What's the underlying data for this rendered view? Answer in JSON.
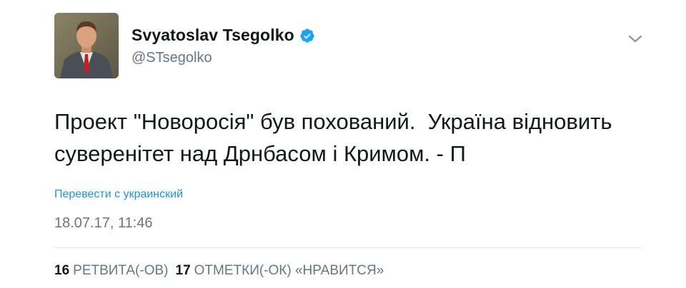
{
  "author": {
    "name": "Svyatoslav Tsegolko",
    "handle": "@STsegolko",
    "verified": true,
    "verified_icon": "verified-badge-icon",
    "avatar_icon": "profile-photo"
  },
  "menu": {
    "icon": "chevron-down-icon"
  },
  "tweet": {
    "text": "Проект \"Новоросія\" був похований.  Україна відновить суверенітет над Дрнбасом і Кримом. - П",
    "translate_label": "Перевести с украинский",
    "timestamp": "18.07.17, 11:46"
  },
  "stats": {
    "retweets_count": "16",
    "retweets_label": "РЕТВИТА(-ОВ)",
    "likes_count": "17",
    "likes_label": "ОТМЕТКИ(-ОК) «НРАВИТСЯ»"
  },
  "colors": {
    "text": "#14171a",
    "secondary": "#657786",
    "link": "#1b95e0",
    "verified": "#1da1f2",
    "divider": "#e1e8ed"
  }
}
